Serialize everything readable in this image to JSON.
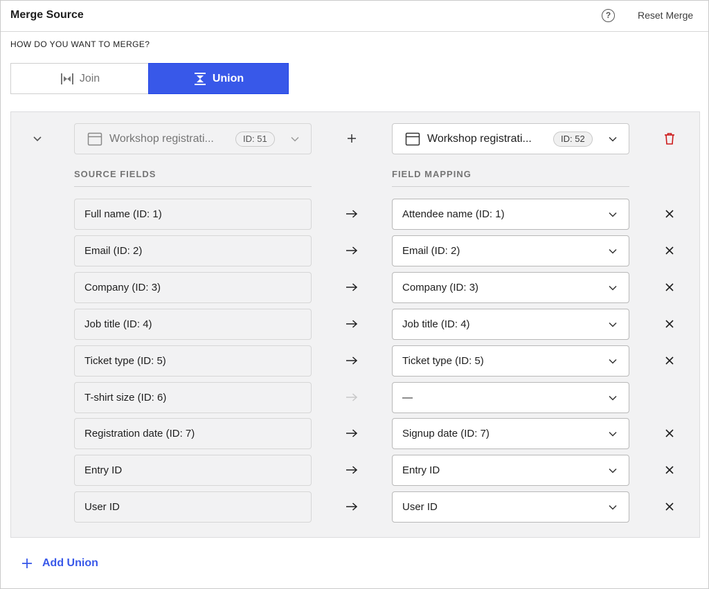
{
  "header": {
    "title": "Merge Source",
    "help_icon": "?",
    "reset_label": "Reset Merge"
  },
  "merge_mode": {
    "label": "HOW DO YOU WANT TO MERGE?",
    "options": [
      {
        "label": "Join",
        "icon": "join-icon",
        "selected": false
      },
      {
        "label": "Union",
        "icon": "union-icon",
        "selected": true
      }
    ]
  },
  "union": {
    "source_form": {
      "name": "Workshop registrati...",
      "id_badge": "ID: 51"
    },
    "target_form": {
      "name": "Workshop registrati...",
      "id_badge": "ID: 52"
    },
    "source_fields_heading": "SOURCE FIELDS",
    "field_mapping_heading": "FIELD MAPPING",
    "rows": [
      {
        "source": "Full name (ID: 1)",
        "target": "Attendee name (ID: 1)",
        "mapped": true
      },
      {
        "source": "Email (ID: 2)",
        "target": "Email (ID: 2)",
        "mapped": true
      },
      {
        "source": "Company (ID: 3)",
        "target": "Company (ID: 3)",
        "mapped": true
      },
      {
        "source": "Job title (ID: 4)",
        "target": "Job title (ID: 4)",
        "mapped": true
      },
      {
        "source": "Ticket type (ID: 5)",
        "target": "Ticket type (ID: 5)",
        "mapped": true
      },
      {
        "source": "T-shirt size (ID: 6)",
        "target": "—",
        "mapped": false
      },
      {
        "source": "Registration date (ID: 7)",
        "target": "Signup date (ID: 7)",
        "mapped": true
      },
      {
        "source": "Entry ID",
        "target": "Entry ID",
        "mapped": true
      },
      {
        "source": "User ID",
        "target": "User ID",
        "mapped": true
      }
    ]
  },
  "add_union_label": "Add Union",
  "colors": {
    "accent": "#3858e9",
    "danger": "#cc1818",
    "panel_bg": "#f2f2f3"
  }
}
